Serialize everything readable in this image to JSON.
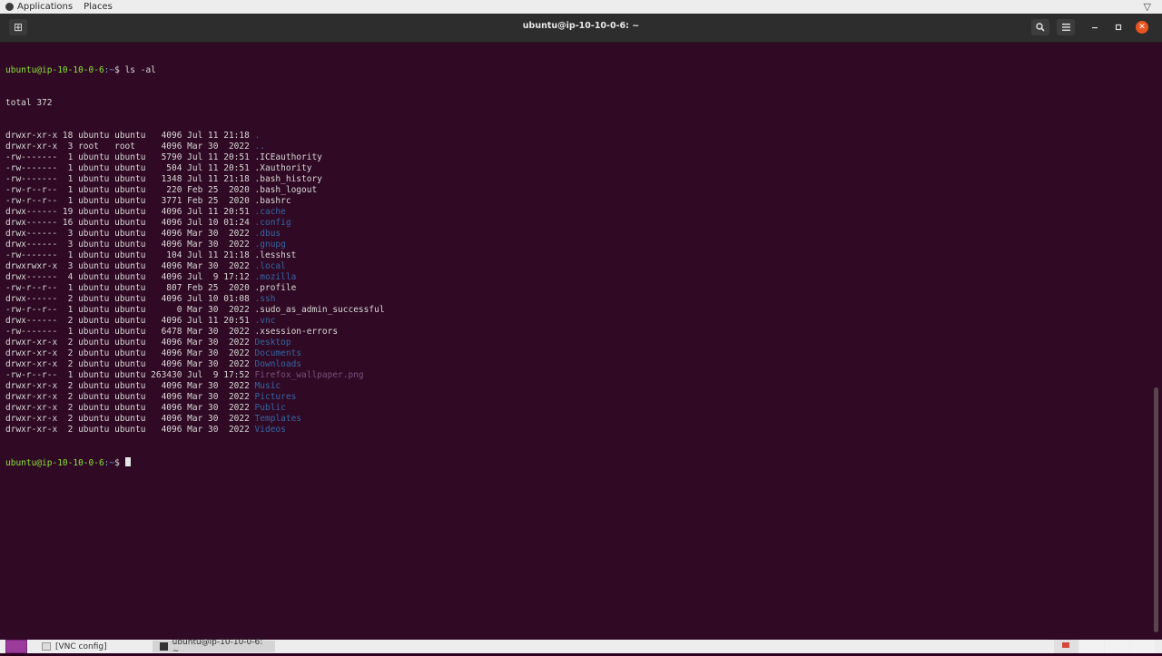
{
  "top_panel": {
    "applications_label": "Applications",
    "places_label": "Places"
  },
  "window": {
    "title": "ubuntu@ip-10-10-0-6: ~",
    "new_tab_icon": "new-tab-icon",
    "search_icon": "search-icon",
    "menu_icon": "hamburger-menu-icon"
  },
  "terminal": {
    "prompt_user": "ubuntu@ip-10-10-0-6",
    "prompt_path": ":~",
    "prompt_symbol": "$ ",
    "command": "ls -al",
    "total_line": "total 372",
    "listing": [
      {
        "prefix": "drwxr-xr-x 18 ubuntu ubuntu   4096 Jul 11 21:18 ",
        "name": ".",
        "kind": "dir"
      },
      {
        "prefix": "drwxr-xr-x  3 root   root     4096 Mar 30  2022 ",
        "name": "..",
        "kind": "dir"
      },
      {
        "prefix": "-rw-------  1 ubuntu ubuntu   5790 Jul 11 20:51 ",
        "name": ".ICEauthority",
        "kind": "file"
      },
      {
        "prefix": "-rw-------  1 ubuntu ubuntu    504 Jul 11 20:51 ",
        "name": ".Xauthority",
        "kind": "file"
      },
      {
        "prefix": "-rw-------  1 ubuntu ubuntu   1348 Jul 11 21:18 ",
        "name": ".bash_history",
        "kind": "file"
      },
      {
        "prefix": "-rw-r--r--  1 ubuntu ubuntu    220 Feb 25  2020 ",
        "name": ".bash_logout",
        "kind": "file"
      },
      {
        "prefix": "-rw-r--r--  1 ubuntu ubuntu   3771 Feb 25  2020 ",
        "name": ".bashrc",
        "kind": "file"
      },
      {
        "prefix": "drwx------ 19 ubuntu ubuntu   4096 Jul 11 20:51 ",
        "name": ".cache",
        "kind": "dir"
      },
      {
        "prefix": "drwx------ 16 ubuntu ubuntu   4096 Jul 10 01:24 ",
        "name": ".config",
        "kind": "dir"
      },
      {
        "prefix": "drwx------  3 ubuntu ubuntu   4096 Mar 30  2022 ",
        "name": ".dbus",
        "kind": "dir"
      },
      {
        "prefix": "drwx------  3 ubuntu ubuntu   4096 Mar 30  2022 ",
        "name": ".gnupg",
        "kind": "dir"
      },
      {
        "prefix": "-rw-------  1 ubuntu ubuntu    104 Jul 11 21:18 ",
        "name": ".lesshst",
        "kind": "file"
      },
      {
        "prefix": "drwxrwxr-x  3 ubuntu ubuntu   4096 Mar 30  2022 ",
        "name": ".local",
        "kind": "dir"
      },
      {
        "prefix": "drwx------  4 ubuntu ubuntu   4096 Jul  9 17:12 ",
        "name": ".mozilla",
        "kind": "dir"
      },
      {
        "prefix": "-rw-r--r--  1 ubuntu ubuntu    807 Feb 25  2020 ",
        "name": ".profile",
        "kind": "file"
      },
      {
        "prefix": "drwx------  2 ubuntu ubuntu   4096 Jul 10 01:08 ",
        "name": ".ssh",
        "kind": "dir"
      },
      {
        "prefix": "-rw-r--r--  1 ubuntu ubuntu      0 Mar 30  2022 ",
        "name": ".sudo_as_admin_successful",
        "kind": "file"
      },
      {
        "prefix": "drwx------  2 ubuntu ubuntu   4096 Jul 11 20:51 ",
        "name": ".vnc",
        "kind": "dir"
      },
      {
        "prefix": "-rw-------  1 ubuntu ubuntu   6478 Mar 30  2022 ",
        "name": ".xsession-errors",
        "kind": "file"
      },
      {
        "prefix": "drwxr-xr-x  2 ubuntu ubuntu   4096 Mar 30  2022 ",
        "name": "Desktop",
        "kind": "dir"
      },
      {
        "prefix": "drwxr-xr-x  2 ubuntu ubuntu   4096 Mar 30  2022 ",
        "name": "Documents",
        "kind": "dir"
      },
      {
        "prefix": "drwxr-xr-x  2 ubuntu ubuntu   4096 Mar 30  2022 ",
        "name": "Downloads",
        "kind": "dir"
      },
      {
        "prefix": "-rw-r--r--  1 ubuntu ubuntu 263430 Jul  9 17:52 ",
        "name": "Firefox_wallpaper.png",
        "kind": "img"
      },
      {
        "prefix": "drwxr-xr-x  2 ubuntu ubuntu   4096 Mar 30  2022 ",
        "name": "Music",
        "kind": "dir"
      },
      {
        "prefix": "drwxr-xr-x  2 ubuntu ubuntu   4096 Mar 30  2022 ",
        "name": "Pictures",
        "kind": "dir"
      },
      {
        "prefix": "drwxr-xr-x  2 ubuntu ubuntu   4096 Mar 30  2022 ",
        "name": "Public",
        "kind": "dir"
      },
      {
        "prefix": "drwxr-xr-x  2 ubuntu ubuntu   4096 Mar 30  2022 ",
        "name": "Templates",
        "kind": "dir"
      },
      {
        "prefix": "drwxr-xr-x  2 ubuntu ubuntu   4096 Mar 30  2022 ",
        "name": "Videos",
        "kind": "dir"
      }
    ]
  },
  "taskbar": {
    "tasks": [
      {
        "label": "[VNC config]"
      },
      {
        "label": "ubuntu@ip-10-10-0-6: ~"
      }
    ]
  },
  "colors": {
    "terminal_bg": "#300a24",
    "prompt_user": "#8ae234",
    "prompt_path": "#729fcf",
    "directory": "#3465a4",
    "image_file": "#75507b",
    "close_button": "#e95420"
  }
}
